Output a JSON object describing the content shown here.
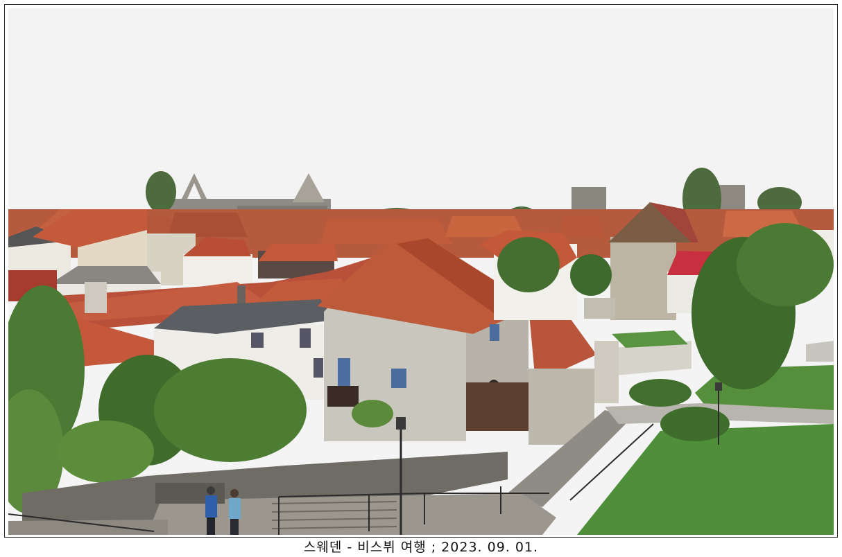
{
  "caption": "스웨덴 - 비스뷔 여행 ; 2023. 09. 01.",
  "photo": {
    "subject": "old-town-rooftops",
    "colors": {
      "sky": "#f3f3f3",
      "roof": "#c45a3b",
      "roof_dark": "#a9472d",
      "stone": "#c9c6bd",
      "stone_dark": "#9e9a90",
      "grass": "#4f8f3a",
      "tree": "#3d6b2c",
      "white_wall": "#ecebe6"
    }
  }
}
